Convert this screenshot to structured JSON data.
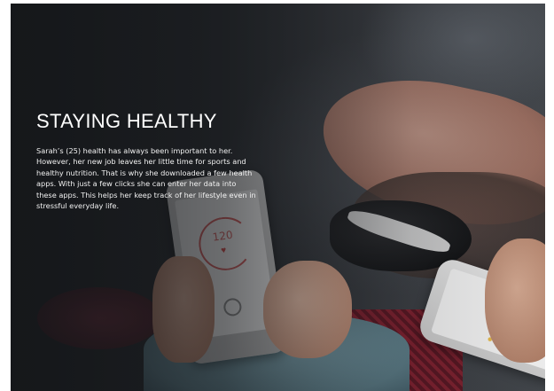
{
  "hero": {
    "title": "STAYING HEALTHY",
    "description": "Sarah’s (25) health has always been important to her. However, her new job leaves her little time for sports and healthy nutrition. That is why she downloaded a few health apps. With just a few clicks she can enter her data into these apps. This helps her keep track of her lifestyle even in stressful everyday life."
  },
  "phone_app": {
    "pulse_value": "120",
    "heart_icon": "heart-icon",
    "fingerprint_icon": "fingerprint-icon"
  }
}
